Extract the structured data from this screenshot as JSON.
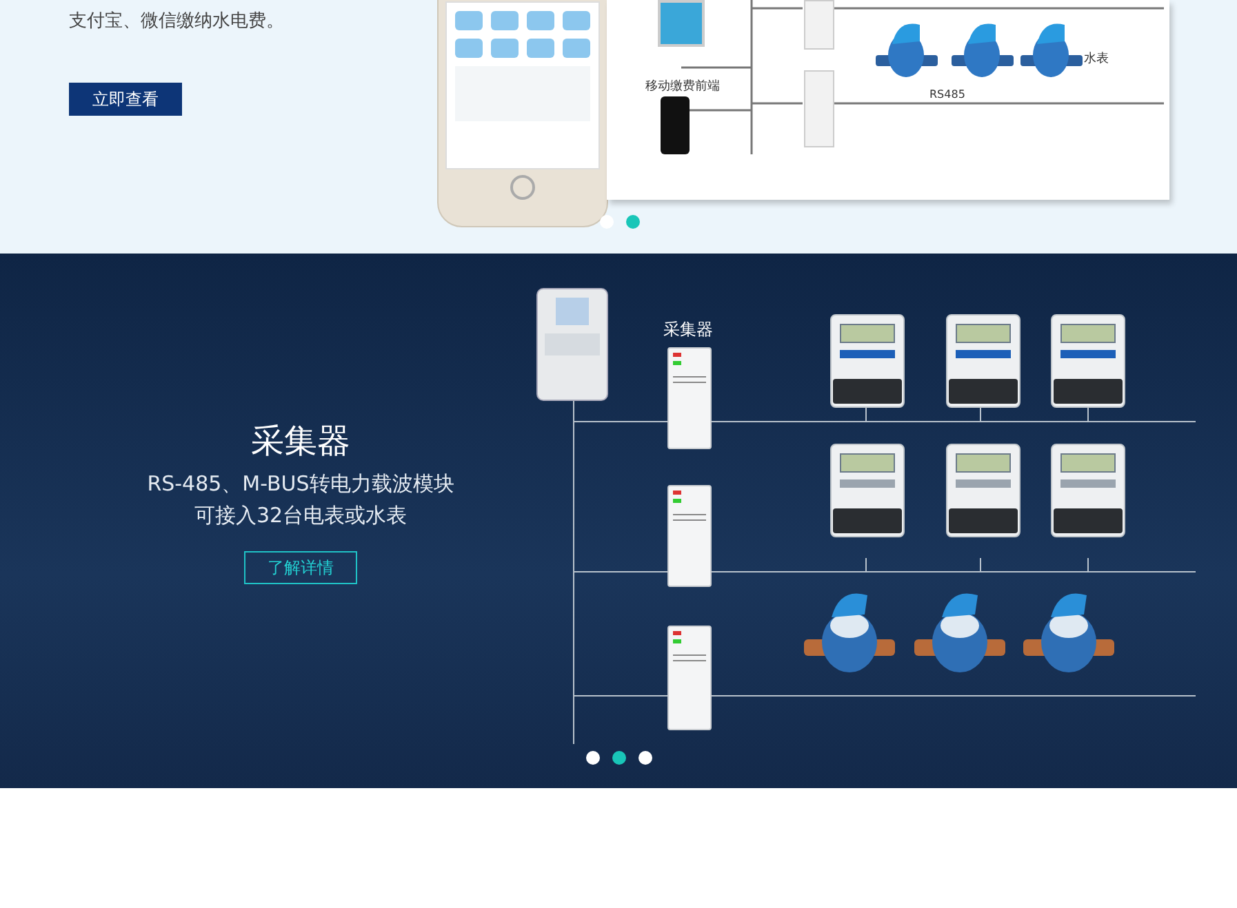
{
  "hero": {
    "description": "支付宝、微信缴纳水电费。",
    "button": "立即查看",
    "diagram": {
      "mobile_label": "移动缴费前端",
      "water_label": "水表",
      "bus_label": "RS485"
    },
    "dots": [
      {
        "selected": false
      },
      {
        "selected": true
      }
    ]
  },
  "collector": {
    "title": "采集器",
    "lines": [
      "RS-485、M-BUS转电力载波模块",
      "可接入32台电表或水表"
    ],
    "button": "了解详情",
    "diagram_label": "采集器",
    "dots": [
      {
        "selected": false
      },
      {
        "selected": true
      },
      {
        "selected": false
      }
    ]
  }
}
